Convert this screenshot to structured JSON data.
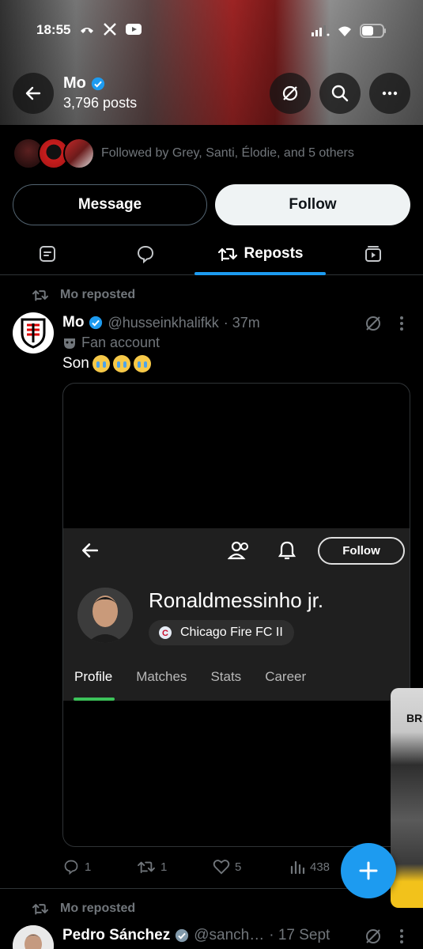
{
  "status": {
    "time": "18:55"
  },
  "header": {
    "name": "Mo",
    "posts": "3,796 posts"
  },
  "followed_by": "Followed by Grey, Santi, Élodie, and 5 others",
  "actions": {
    "message": "Message",
    "follow": "Follow"
  },
  "tabs": {
    "active_label": "Reposts"
  },
  "post1": {
    "repost_label": "Mo reposted",
    "name": "Mo",
    "handle": "@husseinkhalifkk",
    "time": "· 37m",
    "sub": "Fan account",
    "text": "Son",
    "media": {
      "follow": "Follow",
      "player_name": "Ronaldmessinho jr.",
      "club": "Chicago Fire FC II",
      "tabs": [
        "Profile",
        "Matches",
        "Stats",
        "Career"
      ]
    },
    "replies": "1",
    "reposts": "1",
    "likes": "5",
    "views": "438"
  },
  "post2": {
    "repost_label": "Mo reposted",
    "name": "Pedro Sánchez",
    "handle": "@sanch…",
    "time": "· 17 Sept"
  },
  "pip": {
    "text": "BR"
  },
  "colors": {
    "accent": "#1d9bf0",
    "background": "#000000",
    "muted": "#71767b"
  }
}
